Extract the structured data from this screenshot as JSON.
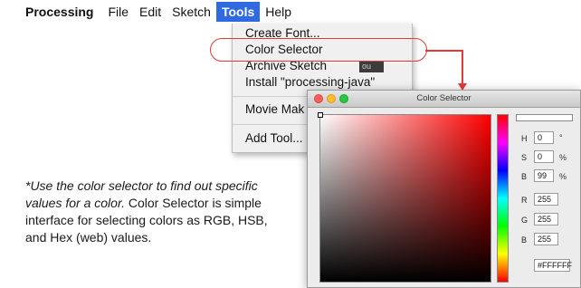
{
  "menubar": {
    "app_name": "Processing",
    "items": [
      "File",
      "Edit",
      "Sketch",
      "Tools",
      "Help"
    ],
    "active_item": "Tools"
  },
  "tools_menu": {
    "items": [
      {
        "label": "Create Font..."
      },
      {
        "label": "Color Selector",
        "highlighted": true
      },
      {
        "label": "Archive Sketch"
      },
      {
        "label": "Install \"processing-java\""
      },
      {
        "label": "Movie Mak"
      },
      {
        "label": "Add Tool..."
      }
    ],
    "behind_text": "ou"
  },
  "annotation_color": "#e43a3a",
  "color_selector": {
    "window_title": "Color Selector",
    "selected_hex": "#FFFFFF",
    "fields": {
      "h_label": "H",
      "h_value": "0",
      "h_unit": "°",
      "s_label": "S",
      "s_value": "0",
      "s_unit": "%",
      "b_label": "B",
      "b_value": "99",
      "b_unit": "%",
      "r_label": "R",
      "r_value": "255",
      "g_label": "G",
      "g_value": "255",
      "b2_label": "B",
      "b2_value": "255",
      "hex_value": "#FFFFFF"
    }
  },
  "caption": {
    "italic": "*Use the color selector to find out specific values for a color.",
    "normal": "Color Selector is simple interface for selecting colors as RGB, HSB, and Hex (web) values."
  }
}
